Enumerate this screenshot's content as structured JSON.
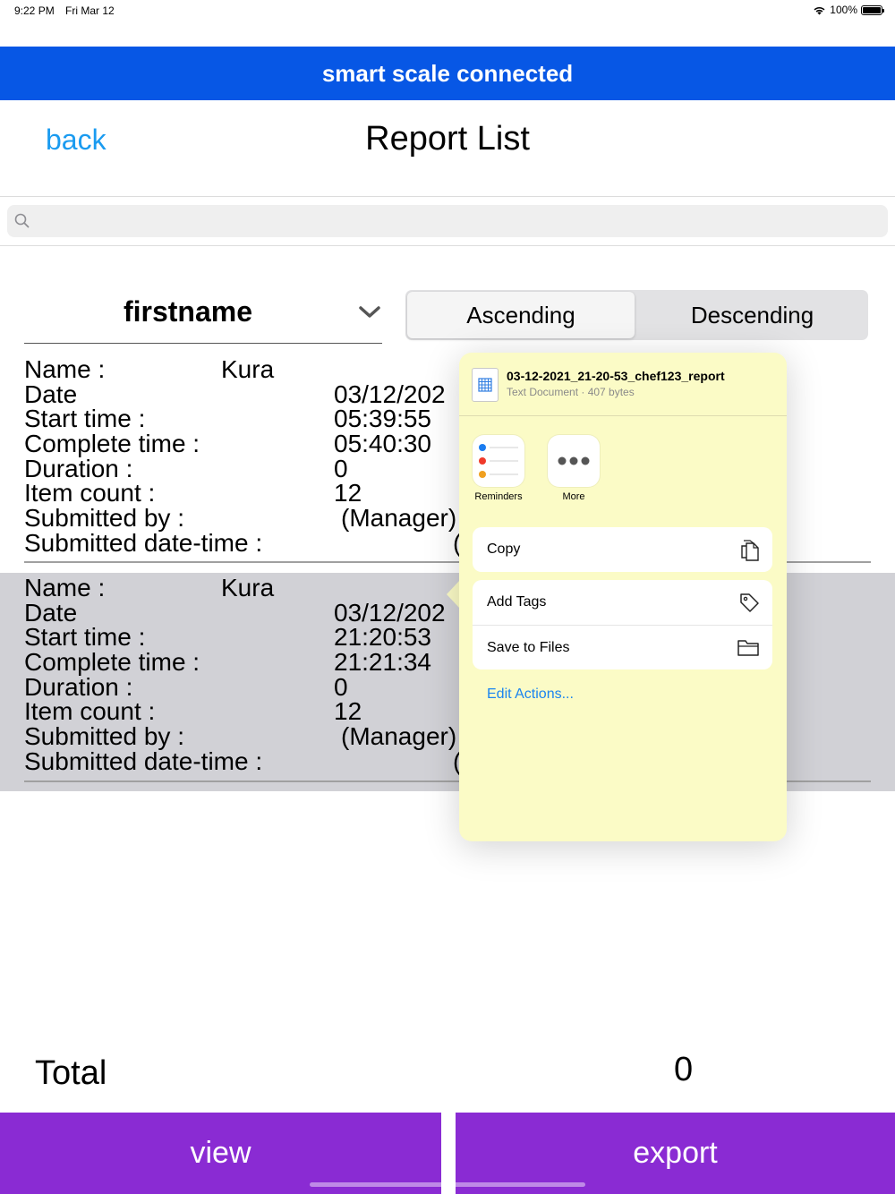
{
  "status_bar": {
    "time": "9:22 PM",
    "date": "Fri Mar 12",
    "battery": "100%"
  },
  "banner": {
    "text": "smart scale connected",
    "color": "#0757e5"
  },
  "nav": {
    "back_label": "back",
    "title": "Report List"
  },
  "search": {
    "placeholder": "",
    "value": ""
  },
  "sort": {
    "field": "firstname",
    "options": [
      "Ascending",
      "Descending"
    ],
    "selected": "Ascending"
  },
  "reports": [
    {
      "name_label": "Name :",
      "name_value": "Kura",
      "date_label": "Date",
      "date_value": "03/12/202",
      "start_label": "Start time :",
      "start_value": "05:39:55",
      "complete_label": "Complete time :",
      "complete_value": "05:40:30",
      "duration_label": "Duration :",
      "duration_value": "0",
      "count_label": "Item count :",
      "count_value": "12",
      "submitted_by_label": "Submitted by :",
      "submitted_by_value": "(Manager)",
      "submitted_dt_label": "Submitted date-time :",
      "submitted_dt_value": "("
    },
    {
      "name_label": "Name :",
      "name_value": "Kura",
      "date_label": "Date",
      "date_value": "03/12/202",
      "start_label": "Start time :",
      "start_value": "21:20:53",
      "complete_label": "Complete time :",
      "complete_value": "21:21:34",
      "duration_label": "Duration :",
      "duration_value": "0",
      "count_label": "Item count :",
      "count_value": "12",
      "submitted_by_label": "Submitted by :",
      "submitted_by_value": "(Manager)",
      "submitted_dt_label": "Submitted date-time :",
      "submitted_dt_value": "("
    }
  ],
  "share_sheet": {
    "file_name": "03-12-2021_21-20-53_chef123_report",
    "file_meta": "Text Document · 407 bytes",
    "apps": [
      {
        "label": "Reminders",
        "icon": "reminders-icon"
      },
      {
        "label": "More",
        "icon": "more-icon"
      }
    ],
    "actions": [
      {
        "label": "Copy",
        "icon": "copy-icon"
      },
      {
        "label": "Add Tags",
        "icon": "tag-icon"
      },
      {
        "label": "Save to Files",
        "icon": "folder-icon"
      }
    ],
    "edit_actions": "Edit Actions..."
  },
  "total": {
    "label": "Total",
    "value": "0"
  },
  "buttons": {
    "view": "view",
    "export": "export",
    "color": "#8a2bd3"
  }
}
